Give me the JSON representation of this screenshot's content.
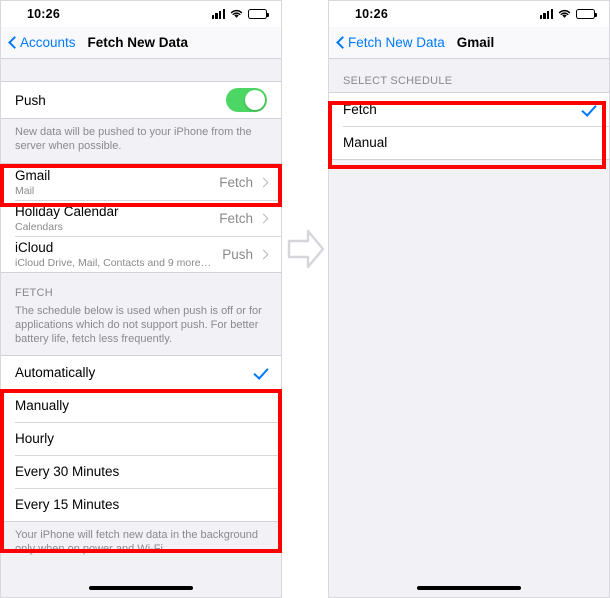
{
  "meta": {
    "accent_blue": "#007aff",
    "highlight_red": "#ff0000",
    "toggle_green": "#4cd663",
    "panel_bg": "#f2f1f6"
  },
  "left_panel": {
    "status": {
      "time": "10:26",
      "cellular_icon": "cellular-bars-icon",
      "wifi_icon": "wifi-icon",
      "battery_icon": "battery-icon"
    },
    "nav": {
      "back_label": "Accounts",
      "back_icon": "chevron-left-icon",
      "title": "Fetch New Data"
    },
    "push": {
      "label": "Push",
      "toggle_state": "on",
      "footnote": "New data will be pushed to your iPhone from the server when possible."
    },
    "accounts": [
      {
        "title": "Gmail",
        "subtitle": "Mail",
        "value": "Fetch",
        "chevron": "chevron-right-icon"
      },
      {
        "title": "Holiday Calendar",
        "subtitle": "Calendars",
        "value": "Fetch",
        "chevron": "chevron-right-icon"
      },
      {
        "title": "iCloud",
        "subtitle": "iCloud Drive, Mail, Contacts and 9 more…",
        "value": "Push",
        "chevron": "chevron-right-icon"
      }
    ],
    "fetch_section": {
      "header": "FETCH",
      "description": "The schedule below is used when push is off or for applications which do not support push. For better battery life, fetch less frequently.",
      "options": [
        {
          "label": "Automatically",
          "selected": true
        },
        {
          "label": "Manually",
          "selected": false
        },
        {
          "label": "Hourly",
          "selected": false
        },
        {
          "label": "Every 30 Minutes",
          "selected": false
        },
        {
          "label": "Every 15 Minutes",
          "selected": false
        }
      ],
      "footnote": "Your iPhone will fetch new data in the background only when on power and Wi-Fi."
    }
  },
  "right_panel": {
    "status": {
      "time": "10:26",
      "cellular_icon": "cellular-bars-icon",
      "wifi_icon": "wifi-icon",
      "battery_icon": "battery-icon"
    },
    "nav": {
      "back_label": "Fetch New Data",
      "back_icon": "chevron-left-icon",
      "title": "Gmail"
    },
    "select_schedule": {
      "header": "SELECT SCHEDULE",
      "options": [
        {
          "label": "Fetch",
          "selected": true
        },
        {
          "label": "Manual",
          "selected": false
        }
      ]
    }
  },
  "arrow": {
    "icon": "right-arrow-icon"
  }
}
